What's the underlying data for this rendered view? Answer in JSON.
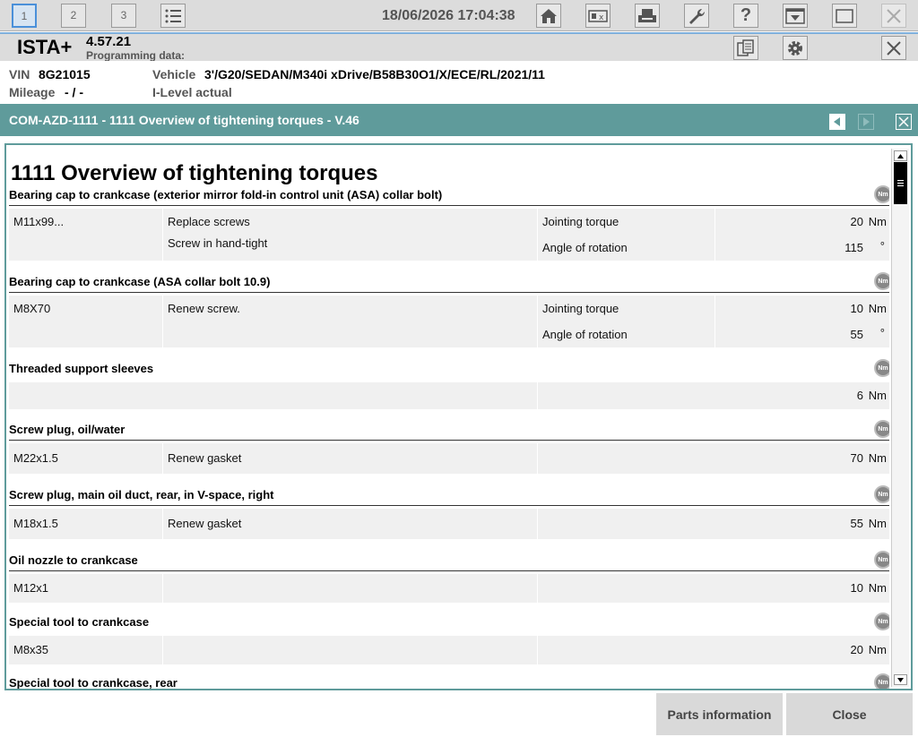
{
  "topbar": {
    "tabs": [
      "1",
      "2",
      "3"
    ],
    "datetime": "18/06/2026 17:04:38",
    "icons": [
      "list-icon",
      "home-icon",
      "compare-icon",
      "print-icon",
      "wrench-icon",
      "help-icon",
      "download-icon",
      "window-icon",
      "close-icon"
    ]
  },
  "header": {
    "app_name": "ISTA+",
    "version": "4.57.21",
    "programming_data": "Programming data:"
  },
  "vehicle": {
    "vin_label": "VIN",
    "vin": "8G21015",
    "vehicle_label": "Vehicle",
    "vehicle": "3'/G20/SEDAN/M340i xDrive/B58B30O1/X/ECE/RL/2021/11",
    "mileage_label": "Mileage",
    "mileage": "- / -",
    "ilevel": "I-Level actual"
  },
  "document": {
    "title": "COM-AZD-1111 - 1111 Overview of tightening torques - V.46",
    "heading": "1111 Overview of tightening torques",
    "sections": [
      {
        "title": "Bearing cap to crankcase (exterior mirror fold-in control unit (ASA) collar bolt)",
        "col1": "M11x99...",
        "col2a": "Replace screws",
        "col2b": "Screw in hand-tight",
        "col3a": "Jointing torque",
        "col3b": "Angle of rotation",
        "val_a": "20",
        "unit_a": "Nm",
        "val_b": "115",
        "unit_b": "°"
      },
      {
        "title": "Bearing cap to crankcase (ASA collar bolt 10.9)",
        "col1": "M8X70",
        "col2a": "Renew screw.",
        "col2b": "",
        "col3a": "Jointing torque",
        "col3b": "Angle of rotation",
        "val_a": "10",
        "unit_a": "Nm",
        "val_b": "55",
        "unit_b": "°"
      },
      {
        "title": "Threaded support sleeves",
        "col1": "",
        "col2a": "",
        "val_a": "6",
        "unit_a": "Nm"
      },
      {
        "title": "Screw plug, oil/water",
        "col1": "M22x1.5",
        "col2a": "Renew gasket",
        "val_a": "70",
        "unit_a": "Nm"
      },
      {
        "title": "Screw plug, main oil duct, rear, in V-space, right",
        "col1": "M18x1.5",
        "col2a": "Renew gasket",
        "val_a": "55",
        "unit_a": "Nm"
      },
      {
        "title": "Oil nozzle to crankcase",
        "col1": "M12x1",
        "col2a": "",
        "val_a": "10",
        "unit_a": "Nm"
      },
      {
        "title": "Special tool to crankcase",
        "col1": "M8x35",
        "col2a": "",
        "val_a": "20",
        "unit_a": "Nm"
      },
      {
        "title": "Special tool to crankcase, rear"
      }
    ],
    "nm_badge": "Nm"
  },
  "footer": {
    "parts_info": "Parts information",
    "close": "Close"
  }
}
